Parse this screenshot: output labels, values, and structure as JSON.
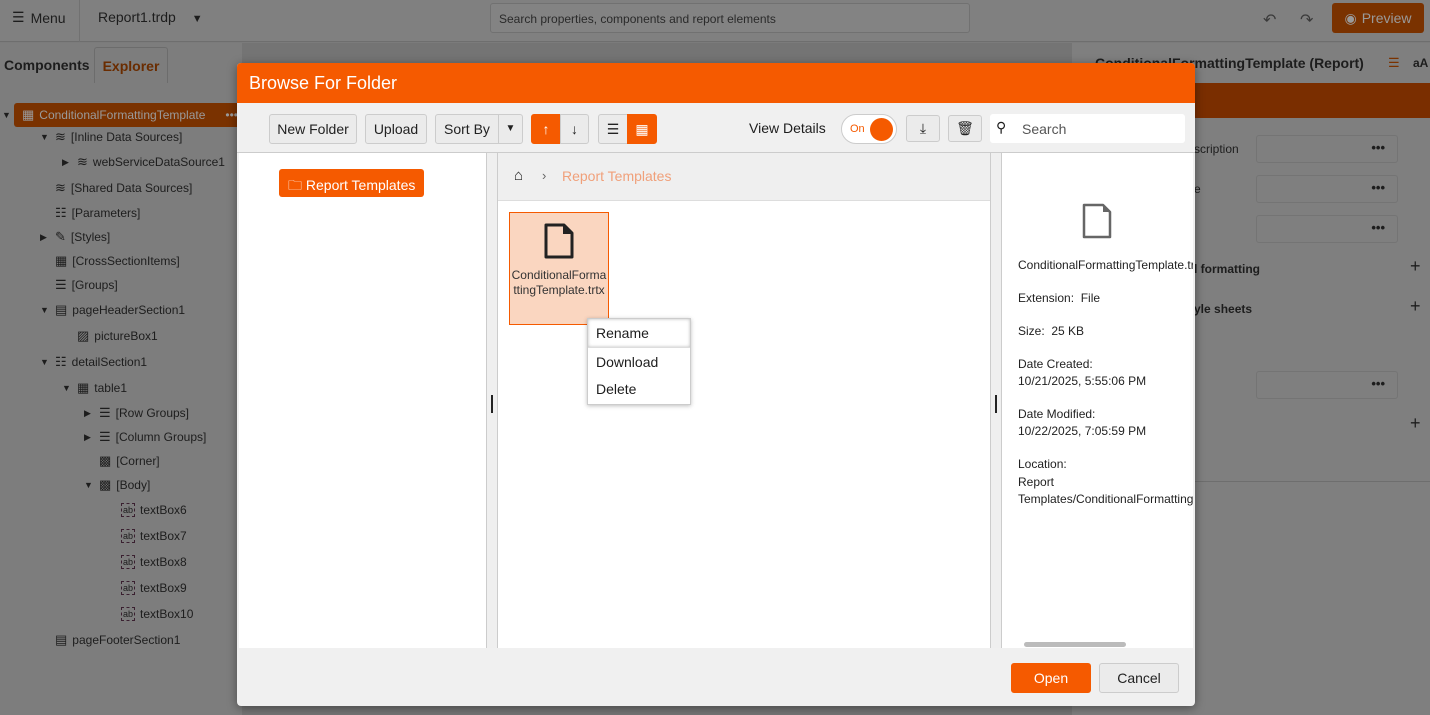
{
  "topbar": {
    "menu": "Menu",
    "file": "Report1.trdp",
    "search_placeholder": "Search properties, components and report elements",
    "preview": "Preview"
  },
  "left_tabs": [
    "Components",
    "Explorer"
  ],
  "tree": [
    {
      "label": "ConditionalFormattingTemplate",
      "level": 0,
      "caret": "▼",
      "selected": true
    },
    {
      "label": "[Inline Data Sources]",
      "level": 1,
      "caret": "▼"
    },
    {
      "label": "webServiceDataSource1",
      "level": 2,
      "caret": "▶"
    },
    {
      "label": "[Shared Data Sources]",
      "level": 1,
      "caret": ""
    },
    {
      "label": "[Parameters]",
      "level": 1,
      "caret": ""
    },
    {
      "label": "[Styles]",
      "level": 1,
      "caret": "▶"
    },
    {
      "label": "[CrossSectionItems]",
      "level": 1,
      "caret": ""
    },
    {
      "label": "[Groups]",
      "level": 1,
      "caret": ""
    },
    {
      "label": "pageHeaderSection1",
      "level": 1,
      "caret": "▼"
    },
    {
      "label": "pictureBox1",
      "level": 2,
      "caret": ""
    },
    {
      "label": "detailSection1",
      "level": 1,
      "caret": "▼"
    },
    {
      "label": "table1",
      "level": 2,
      "caret": "▼"
    },
    {
      "label": "[Row Groups]",
      "level": 3,
      "caret": "▶"
    },
    {
      "label": "[Column Groups]",
      "level": 3,
      "caret": "▶"
    },
    {
      "label": "[Corner]",
      "level": 3,
      "caret": ""
    },
    {
      "label": "[Body]",
      "level": 3,
      "caret": "▼"
    },
    {
      "label": "textBox6",
      "level": 4,
      "caret": ""
    },
    {
      "label": "textBox7",
      "level": 4,
      "caret": ""
    },
    {
      "label": "textBox8",
      "level": 4,
      "caret": ""
    },
    {
      "label": "textBox9",
      "level": 4,
      "caret": ""
    },
    {
      "label": "textBox10",
      "level": 4,
      "caret": ""
    },
    {
      "label": "pageFooterSection1",
      "level": 1,
      "caret": ""
    }
  ],
  "right_panel": {
    "title": "ConditionalFormattingTemplate (Report)",
    "font_toggle": "aA",
    "rows": [
      "scription",
      "e",
      "",
      "l formatting",
      "yle sheets"
    ]
  },
  "dialog": {
    "title": "Browse For Folder",
    "toolbar": {
      "new_folder": "New Folder",
      "upload": "Upload",
      "sort_by": "Sort By",
      "view_details": "View Details",
      "toggle": "On",
      "search_placeholder": "Search"
    },
    "folder": "Report Templates",
    "breadcrumb": "Report Templates",
    "file_name": "ConditionalFormattingTemplate.trtx",
    "context_menu": [
      "Rename",
      "Download",
      "Delete"
    ],
    "details": {
      "name": "ConditionalFormattingTemplate.trtx",
      "extension_label": "Extension:",
      "extension": "File",
      "size_label": "Size:",
      "size": "25 KB",
      "created_label": "Date Created:",
      "created": "10/21/2025, 5:55:06 PM",
      "modified_label": "Date Modified:",
      "modified": "10/22/2025, 7:05:59 PM",
      "location_label": "Location:",
      "location": "Report Templates/ConditionalFormattingTemplate.trtx"
    },
    "open": "Open",
    "cancel": "Cancel"
  },
  "colors": {
    "accent": "#f55a00"
  }
}
